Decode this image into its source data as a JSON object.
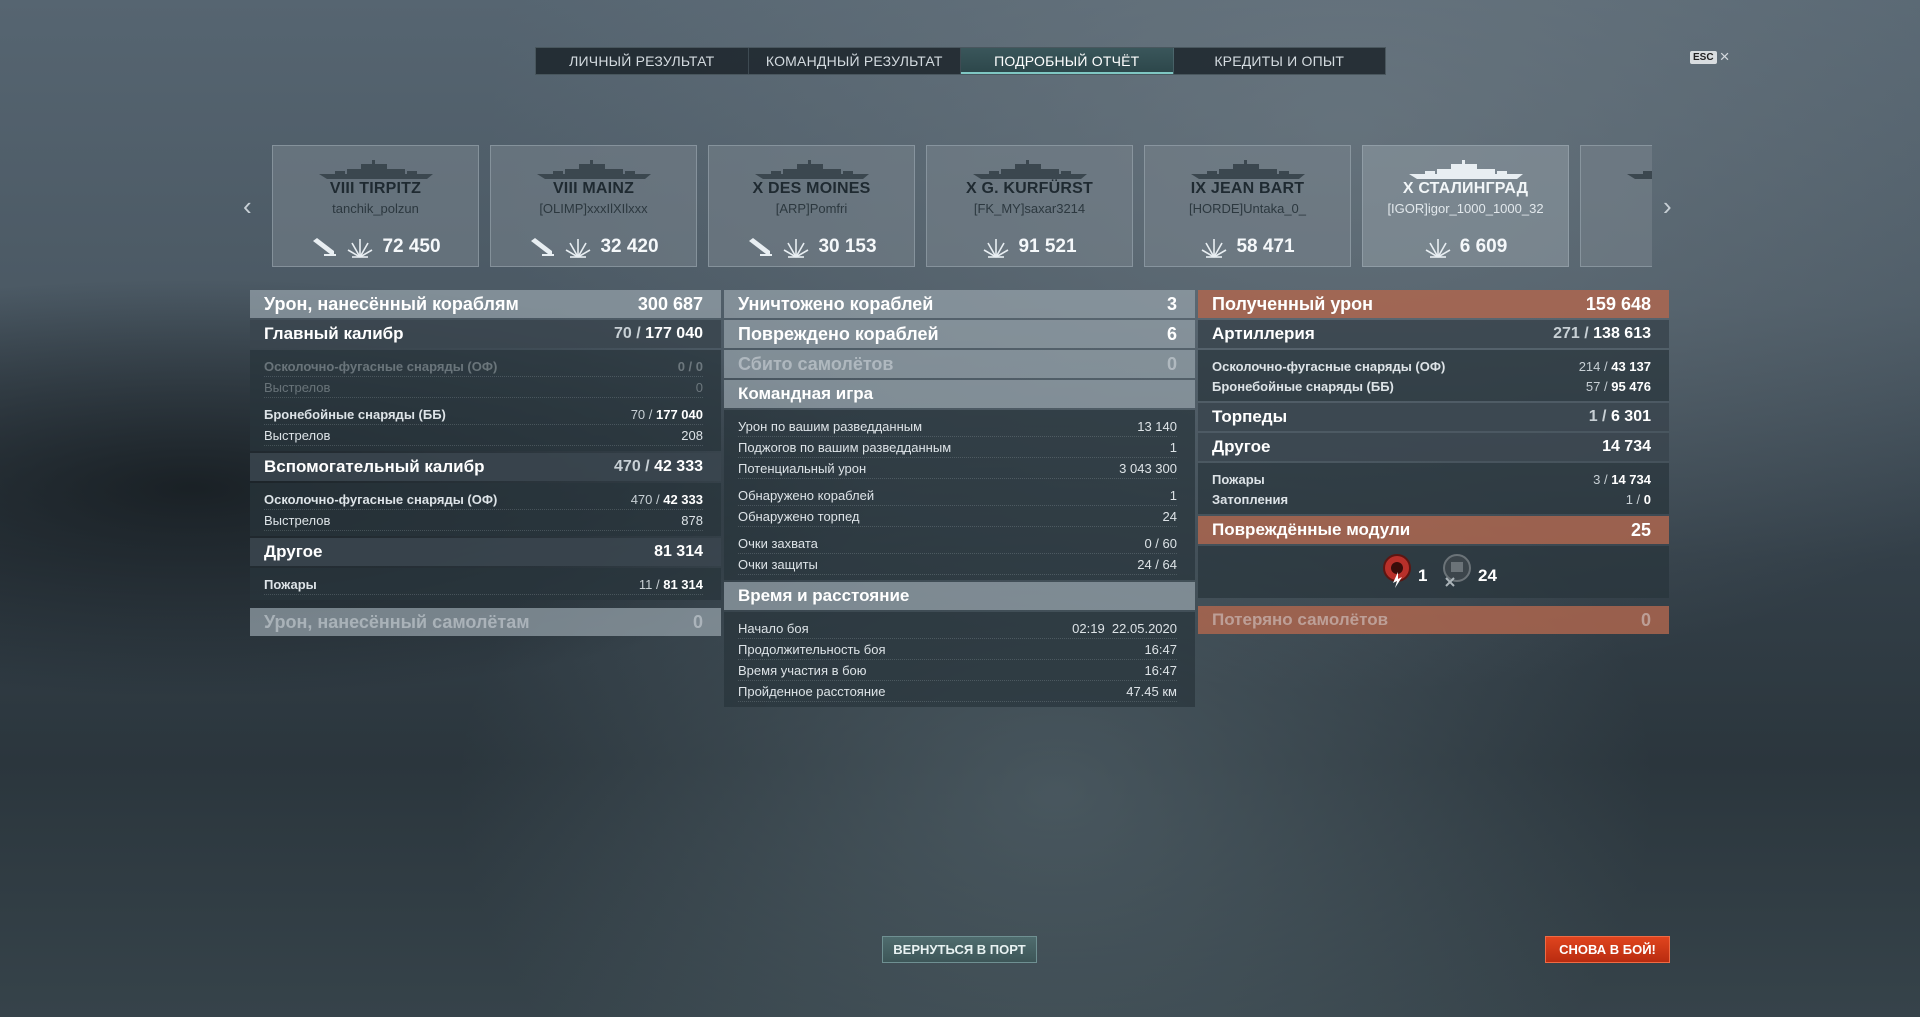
{
  "tabs": [
    {
      "label": "ЛИЧНЫЙ РЕЗУЛЬТАТ"
    },
    {
      "label": "КОМАНДНЫЙ РЕЗУЛЬТАТ"
    },
    {
      "label": "ПОДРОБНЫЙ ОТЧЁТ",
      "active": true
    },
    {
      "label": "КРЕДИТЫ И ОПЫТ"
    }
  ],
  "esc": {
    "key": "ESC",
    "close": "×"
  },
  "ships": [
    {
      "name": "VIII TIRPITZ",
      "player": "tanchik_polzun",
      "score": "72 450",
      "torpedo_icon": true
    },
    {
      "name": "VIII MAINZ",
      "player": "[OLIMP]xxxIlXIlxxx",
      "score": "32 420",
      "torpedo_icon": true
    },
    {
      "name": "X DES MOINES",
      "player": "[ARP]Pomfri",
      "score": "30 153",
      "torpedo_icon": true
    },
    {
      "name": "X G. KURFÜRST",
      "player": "[FK_MY]saxar3214",
      "score": "91 521",
      "torpedo_icon": false
    },
    {
      "name": "IX JEAN BART",
      "player": "[HORDE]Untaka_0_",
      "score": "58 471",
      "torpedo_icon": false
    },
    {
      "name": "X СТАЛИНГРАД",
      "player": "[IGOR]igor_1000_1000_32",
      "score": "6 609",
      "torpedo_icon": false,
      "highlight": true
    },
    {
      "name": "",
      "player": "[...",
      "score": "",
      "torpedo_icon": false
    }
  ],
  "left": {
    "damage_ships": {
      "label": "Урон, нанесённый кораблям",
      "value": "300 687"
    },
    "main_caliber": {
      "label": "Главный калибр",
      "hits": "70",
      "value": "177 040"
    },
    "he_shells": {
      "label": "Осколочно-фугасные снаряды (ОФ)",
      "value": "0 / 0"
    },
    "he_shots": {
      "label": "Выстрелов",
      "value": "0"
    },
    "ap_shells": {
      "label": "Бронебойные снаряды (ББ)",
      "hits": "70",
      "value": "177 040"
    },
    "ap_shots": {
      "label": "Выстрелов",
      "value": "208"
    },
    "secondary": {
      "label": "Вспомогательный калибр",
      "hits": "470",
      "value": "42 333"
    },
    "sec_he": {
      "label": "Осколочно-фугасные снаряды (ОФ)",
      "hits": "470",
      "value": "42 333"
    },
    "sec_shots": {
      "label": "Выстрелов",
      "value": "878"
    },
    "other": {
      "label": "Другое",
      "value": "81 314"
    },
    "fires": {
      "label": "Пожары",
      "hits": "11",
      "value": "81 314"
    },
    "damage_planes": {
      "label": "Урон, нанесённый самолётам",
      "value": "0"
    }
  },
  "middle": {
    "destroyed": {
      "label": "Уничтожено кораблей",
      "value": "3"
    },
    "damaged": {
      "label": "Повреждено кораблей",
      "value": "6"
    },
    "planes_shot": {
      "label": "Сбито самолётов",
      "value": "0"
    },
    "team_play": {
      "label": "Командная игра"
    },
    "spot_damage": {
      "label": "Урон по вашим разведданным",
      "value": "13 140"
    },
    "spot_fires": {
      "label": "Поджогов по вашим разведданным",
      "value": "1"
    },
    "potential": {
      "label": "Потенциальный урон",
      "value": "3 043 300"
    },
    "spotted_ships": {
      "label": "Обнаружено кораблей",
      "value": "1"
    },
    "spotted_torps": {
      "label": "Обнаружено торпед",
      "value": "24"
    },
    "capture": {
      "label": "Очки захвата",
      "value": "0 / 60"
    },
    "defense": {
      "label": "Очки защиты",
      "value": "24 / 64"
    },
    "time_distance": {
      "label": "Время и расстояние"
    },
    "start": {
      "label": "Начало боя",
      "value": "02:19  22.05.2020"
    },
    "duration": {
      "label": "Продолжительность боя",
      "value": "16:47"
    },
    "participation": {
      "label": "Время участия в бою",
      "value": "16:47"
    },
    "distance": {
      "label": "Пройденное расстояние",
      "value": "47.45 км"
    }
  },
  "right": {
    "received": {
      "label": "Полученный урон",
      "value": "159 648"
    },
    "artillery": {
      "label": "Артиллерия",
      "hits": "271",
      "value": "138 613"
    },
    "he": {
      "label": "Осколочно-фугасные снаряды (ОФ)",
      "hits": "214",
      "value": "43 137"
    },
    "ap": {
      "label": "Бронебойные снаряды (ББ)",
      "hits": "57",
      "value": "95 476"
    },
    "torpedoes": {
      "label": "Торпеды",
      "hits": "1",
      "value": "6 301"
    },
    "other": {
      "label": "Другое",
      "value": "14 734"
    },
    "fires": {
      "label": "Пожары",
      "hits": "3",
      "value": "14 734"
    },
    "floods": {
      "label": "Затопления",
      "hits": "1",
      "value": "0"
    },
    "modules": {
      "label": "Повреждённые модули",
      "value": "25"
    },
    "module_icons": [
      {
        "icon": "engine-damage-icon",
        "count": "1",
        "color": "#c0362a"
      },
      {
        "icon": "turret-damage-icon",
        "count": "24",
        "color": "#6b7378"
      }
    ],
    "planes_lost": {
      "label": "Потеряно самолётов",
      "value": "0"
    }
  },
  "buttons": {
    "port": "ВЕРНУТЬСЯ В ПОРТ",
    "battle": "СНОВА В БОЙ!"
  }
}
